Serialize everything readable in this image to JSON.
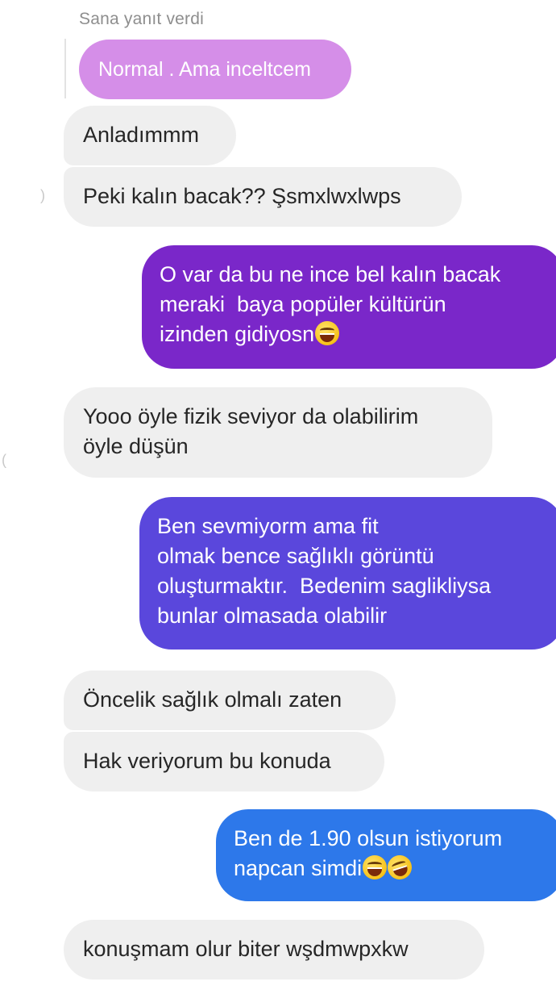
{
  "reply_header": "Sana yanıt verdi",
  "quoted_message": "Normal . Ama inceltcem",
  "messages": [
    {
      "side": "in",
      "text": "Anladımmm"
    },
    {
      "side": "in",
      "text": "Peki kalın bacak?? Şsmxlwxlwps"
    },
    {
      "side": "out",
      "lines": [
        "O var da bu ne ince bel kalın bacak",
        "meraki  baya popüler kültürün",
        "izinden gidiyosn"
      ],
      "emoji": [
        "grinning-face-smiling-eyes"
      ]
    },
    {
      "side": "in",
      "lines": [
        "Yooo öyle fizik seviyor da olabilirim",
        "öyle düşün"
      ]
    },
    {
      "side": "out",
      "lines": [
        "Ben sevmiyorm ama fit",
        "olmak bence sağlıklı görüntü",
        "oluşturmaktır.  Bedenim saglikliysa",
        "bunlar olmasada olabilir"
      ]
    },
    {
      "side": "in",
      "text": "Öncelik sağlık olmalı zaten"
    },
    {
      "side": "in",
      "text": "Hak veriyorum bu konuda"
    },
    {
      "side": "out",
      "lines": [
        "Ben de 1.90 olsun istiyorum",
        "napcan simdi"
      ],
      "emoji": [
        "face-with-tears-of-joy",
        "rolling-on-floor-laughing"
      ]
    },
    {
      "side": "in",
      "text": "konuşmam olur biter wşdmwpxkw"
    }
  ],
  "colors": {
    "quoted_bubble": "#d58ee8",
    "incoming_bubble": "#efefef",
    "outgoing_1": "#7a27c9",
    "outgoing_2": "#5a47dc",
    "outgoing_3": "#2d78ea"
  }
}
